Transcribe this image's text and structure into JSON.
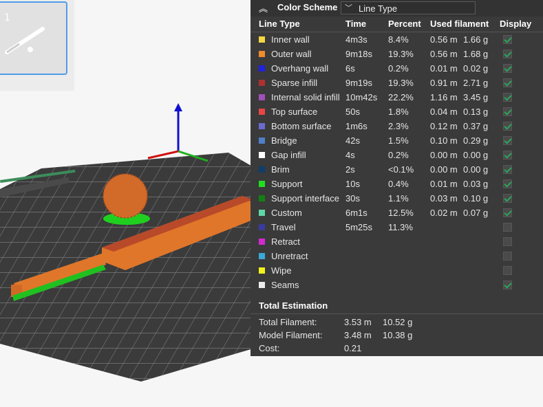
{
  "thumbnail": {
    "index": "1"
  },
  "panel": {
    "title": "Color Scheme",
    "select_value": "Line Type",
    "columns": {
      "line_type": "Line Type",
      "time": "Time",
      "percent": "Percent",
      "used": "Used filament",
      "display": "Display"
    },
    "rows": [
      {
        "label": "Inner wall",
        "time": "4m3s",
        "percent": "8.4%",
        "m": "0.56 m",
        "g": "1.66 g",
        "color": "#f5d641",
        "checked": true
      },
      {
        "label": "Outer wall",
        "time": "9m18s",
        "percent": "19.3%",
        "m": "0.56 m",
        "g": "1.68 g",
        "color": "#f08c2c",
        "checked": true
      },
      {
        "label": "Overhang wall",
        "time": "6s",
        "percent": "0.2%",
        "m": "0.01 m",
        "g": "0.02 g",
        "color": "#2020e0",
        "checked": true
      },
      {
        "label": "Sparse infill",
        "time": "9m19s",
        "percent": "19.3%",
        "m": "0.91 m",
        "g": "2.71 g",
        "color": "#b03030",
        "checked": true
      },
      {
        "label": "Internal solid infill",
        "time": "10m42s",
        "percent": "22.2%",
        "m": "1.16 m",
        "g": "3.45 g",
        "color": "#9f50b8",
        "checked": true
      },
      {
        "label": "Top surface",
        "time": "50s",
        "percent": "1.8%",
        "m": "0.04 m",
        "g": "0.13 g",
        "color": "#e84545",
        "checked": true
      },
      {
        "label": "Bottom surface",
        "time": "1m6s",
        "percent": "2.3%",
        "m": "0.12 m",
        "g": "0.37 g",
        "color": "#6a6ad0",
        "checked": true
      },
      {
        "label": "Bridge",
        "time": "42s",
        "percent": "1.5%",
        "m": "0.10 m",
        "g": "0.29 g",
        "color": "#4f7fc8",
        "checked": true
      },
      {
        "label": "Gap infill",
        "time": "4s",
        "percent": "0.2%",
        "m": "0.00 m",
        "g": "0.00 g",
        "color": "#ffffff",
        "checked": true
      },
      {
        "label": "Brim",
        "time": "2s",
        "percent": "<0.1%",
        "m": "0.00 m",
        "g": "0.00 g",
        "color": "#0e3e6e",
        "checked": true
      },
      {
        "label": "Support",
        "time": "10s",
        "percent": "0.4%",
        "m": "0.01 m",
        "g": "0.03 g",
        "color": "#1fe01f",
        "checked": true
      },
      {
        "label": "Support interface",
        "time": "30s",
        "percent": "1.1%",
        "m": "0.03 m",
        "g": "0.10 g",
        "color": "#128012",
        "checked": true
      },
      {
        "label": "Custom",
        "time": "6m1s",
        "percent": "12.5%",
        "m": "0.02 m",
        "g": "0.07 g",
        "color": "#5ed8a8",
        "checked": true
      },
      {
        "label": "Travel",
        "time": "5m25s",
        "percent": "11.3%",
        "m": "",
        "g": "",
        "color": "#3a3aa0",
        "checked": false
      },
      {
        "label": "Retract",
        "time": "",
        "percent": "",
        "m": "",
        "g": "",
        "color": "#d22ad2",
        "checked": false
      },
      {
        "label": "Unretract",
        "time": "",
        "percent": "",
        "m": "",
        "g": "",
        "color": "#3aa8d8",
        "checked": false
      },
      {
        "label": "Wipe",
        "time": "",
        "percent": "",
        "m": "",
        "g": "",
        "color": "#f2f21a",
        "checked": false
      },
      {
        "label": "Seams",
        "time": "",
        "percent": "",
        "m": "",
        "g": "",
        "color": "#ececec",
        "checked": true
      }
    ],
    "total": {
      "title": "Total Estimation",
      "total_label": "Total Filament:",
      "total_m": "3.53 m",
      "total_g": "10.52 g",
      "model_label": "Model Filament:",
      "model_m": "3.48 m",
      "model_g": "10.38 g",
      "cost_label": "Cost:",
      "cost_value": "0.21"
    }
  }
}
